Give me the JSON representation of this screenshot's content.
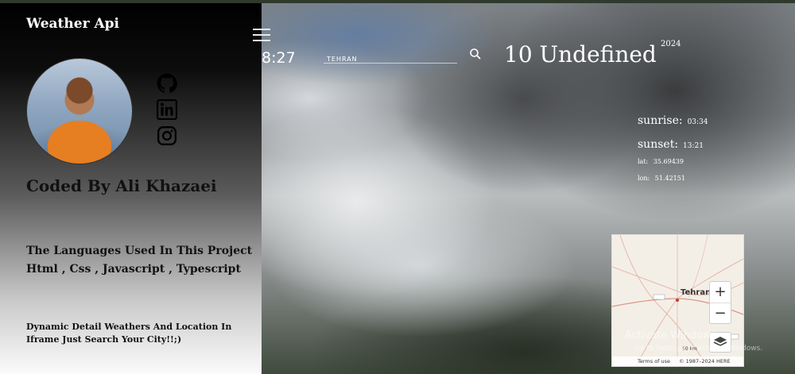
{
  "app": {
    "title": "Weather Api"
  },
  "profile": {
    "author": "Coded By Ali Khazaei",
    "languages": "The Languages Used In This Project Html , Css , Javascript , Typescript",
    "description": "Dynamic Detail Weathers And Location In Iframe Just Search Your City!!;)"
  },
  "social": [
    "github-icon",
    "linkedin-icon",
    "instagram-icon"
  ],
  "header": {
    "time": "8:27",
    "search_value": "TEHRAN",
    "date_text": "10 Undefined",
    "year": "2024"
  },
  "details": {
    "sunrise_label": "sunrise:",
    "sunrise_value": "03:34",
    "sunset_label": "sunset:",
    "sunset_value": "13:21",
    "lat_label": "lat:",
    "lat_value": "35.69439",
    "lon_label": "lon:",
    "lon_value": "51.42151"
  },
  "map": {
    "city": "Tehran",
    "zoom_in": "+",
    "zoom_out": "−",
    "scale": "50 km",
    "terms": "Terms of use",
    "copyright": "© 1987–2024 HERE"
  },
  "watermark": {
    "title": "Activate Windows",
    "subtitle": "Go to Settings to activate Windows."
  }
}
